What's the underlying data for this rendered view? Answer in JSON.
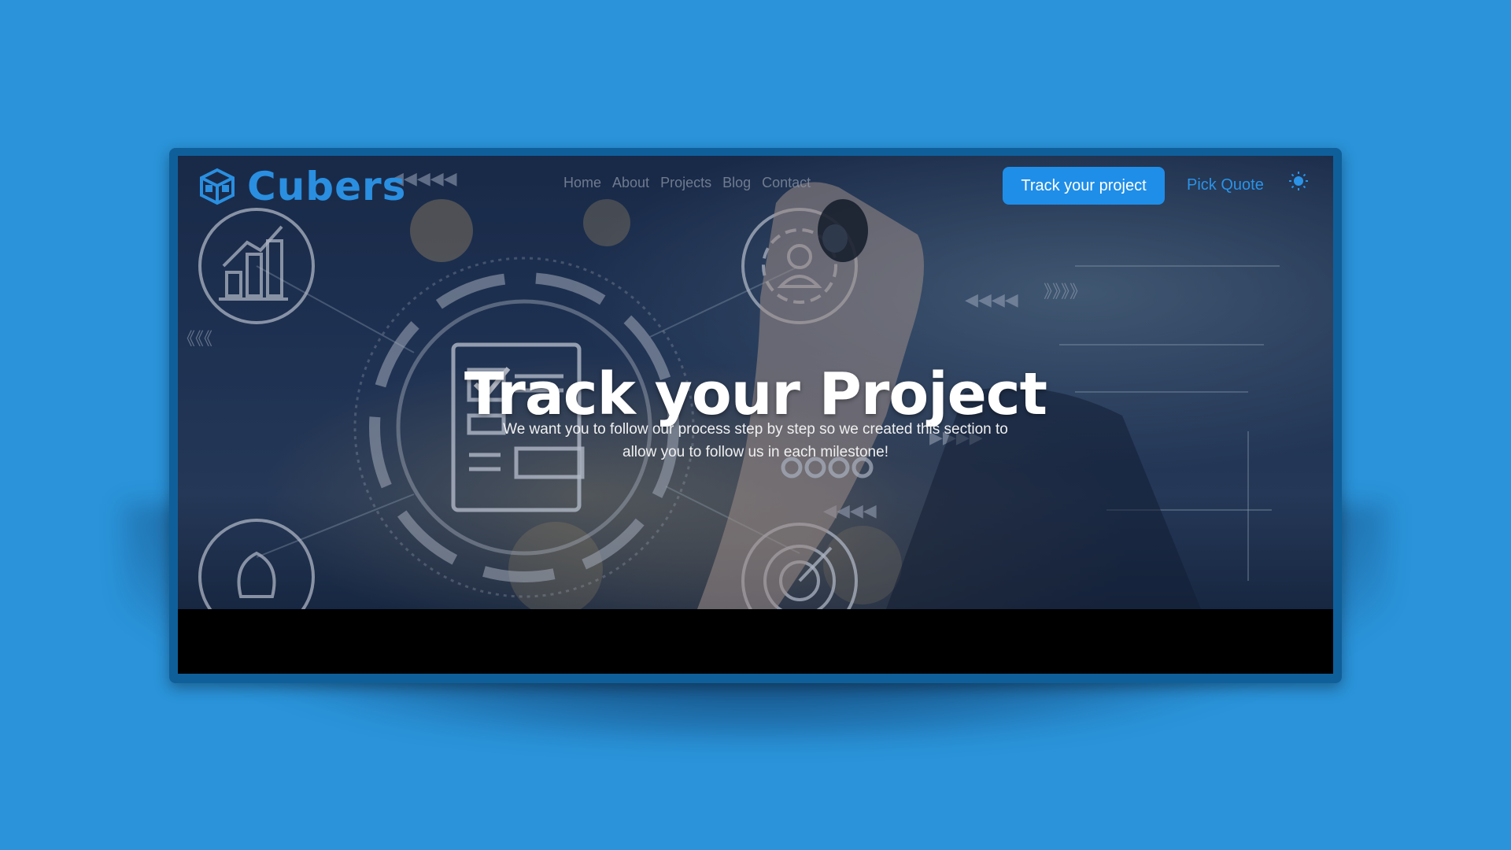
{
  "brand": {
    "name": "Cubers",
    "color": "#2a8fe0"
  },
  "nav": {
    "items": [
      "Home",
      "About",
      "Projects",
      "Blog",
      "Contact"
    ]
  },
  "actions": {
    "track_button": "Track your project",
    "quote_link": "Pick Quote",
    "theme_icon": "sun-icon"
  },
  "hero": {
    "title": "Track your Project",
    "subtitle": "We want you to follow our process step by step so we created this section to allow you to follow us in each milestone!"
  },
  "colors": {
    "page_background": "#2a93d9",
    "frame": "#0f5f9a",
    "accent": "#1f8ee8"
  }
}
